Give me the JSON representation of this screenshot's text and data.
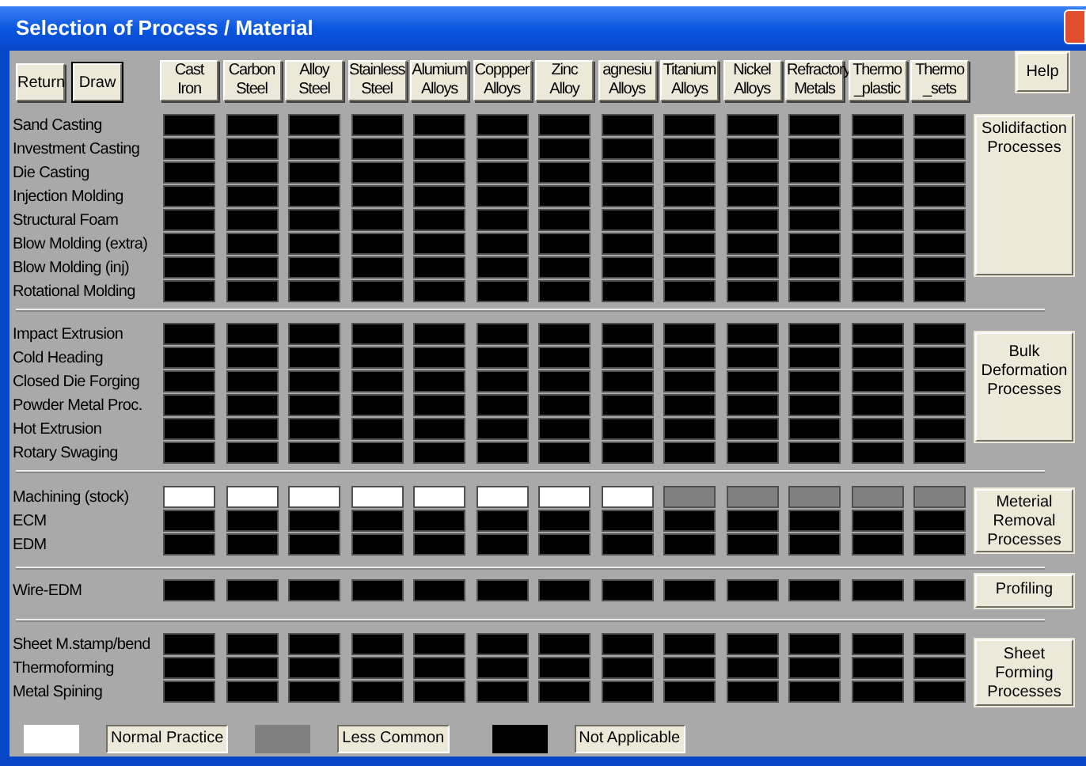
{
  "window": {
    "title": "Selection of Process / Material"
  },
  "toolbar": [
    {
      "label": "Return",
      "default": false
    },
    {
      "label": "Draw",
      "default": true
    }
  ],
  "help_button": "Help",
  "materials": [
    "Cast\nIron",
    "Carbon\nSteel",
    "Alloy\nSteel",
    "Stainless\nSteel",
    "Alumium\nAlloys",
    "Coppper\nAlloys",
    "Zinc\nAlloy",
    "agnesiu\nAlloys",
    "Titanium\nAlloys",
    "Nickel\nAlloys",
    "Refractory\nMetals",
    "Thermo\n_plastic",
    "Thermo\n_sets"
  ],
  "groups": [
    {
      "category": "Solidifaction\nProcesses",
      "processes": [
        {
          "name": "Sand Casting",
          "cells": [
            {
              "kind": "na"
            },
            {
              "kind": "na"
            },
            {
              "kind": "na"
            },
            {
              "kind": "na"
            },
            {
              "kind": "na"
            },
            {
              "kind": "na"
            },
            {
              "kind": "na"
            },
            {
              "kind": "na"
            },
            {
              "kind": "na"
            },
            {
              "kind": "na"
            },
            {
              "kind": "na"
            },
            {
              "kind": "na"
            },
            {
              "kind": "na"
            }
          ]
        },
        {
          "name": "Investment Casting",
          "cells": [
            {
              "kind": "na"
            },
            {
              "kind": "na"
            },
            {
              "kind": "na"
            },
            {
              "kind": "na"
            },
            {
              "kind": "na"
            },
            {
              "kind": "na"
            },
            {
              "kind": "na"
            },
            {
              "kind": "na"
            },
            {
              "kind": "na"
            },
            {
              "kind": "na"
            },
            {
              "kind": "na"
            },
            {
              "kind": "na"
            },
            {
              "kind": "na"
            }
          ]
        },
        {
          "name": "Die Casting",
          "cells": [
            {
              "kind": "na"
            },
            {
              "kind": "na"
            },
            {
              "kind": "na"
            },
            {
              "kind": "na"
            },
            {
              "kind": "na"
            },
            {
              "kind": "na"
            },
            {
              "kind": "na"
            },
            {
              "kind": "na"
            },
            {
              "kind": "na"
            },
            {
              "kind": "na"
            },
            {
              "kind": "na"
            },
            {
              "kind": "na"
            },
            {
              "kind": "na"
            }
          ]
        },
        {
          "name": "Injection Molding",
          "cells": [
            {
              "kind": "na"
            },
            {
              "kind": "na"
            },
            {
              "kind": "na"
            },
            {
              "kind": "na"
            },
            {
              "kind": "na"
            },
            {
              "kind": "na"
            },
            {
              "kind": "na"
            },
            {
              "kind": "na"
            },
            {
              "kind": "na"
            },
            {
              "kind": "na"
            },
            {
              "kind": "na"
            },
            {
              "kind": "na"
            },
            {
              "kind": "na"
            }
          ]
        },
        {
          "name": "Structural Foam",
          "cells": [
            {
              "kind": "na"
            },
            {
              "kind": "na"
            },
            {
              "kind": "na"
            },
            {
              "kind": "na"
            },
            {
              "kind": "na"
            },
            {
              "kind": "na"
            },
            {
              "kind": "na"
            },
            {
              "kind": "na"
            },
            {
              "kind": "na"
            },
            {
              "kind": "na"
            },
            {
              "kind": "na"
            },
            {
              "kind": "na"
            },
            {
              "kind": "na"
            }
          ]
        },
        {
          "name": "Blow Molding (extra)",
          "cells": [
            {
              "kind": "na"
            },
            {
              "kind": "na"
            },
            {
              "kind": "na"
            },
            {
              "kind": "na"
            },
            {
              "kind": "na"
            },
            {
              "kind": "na"
            },
            {
              "kind": "na"
            },
            {
              "kind": "na"
            },
            {
              "kind": "na"
            },
            {
              "kind": "na"
            },
            {
              "kind": "na"
            },
            {
              "kind": "na"
            },
            {
              "kind": "na"
            }
          ]
        },
        {
          "name": "Blow Molding (inj)",
          "cells": [
            {
              "kind": "na"
            },
            {
              "kind": "na"
            },
            {
              "kind": "na"
            },
            {
              "kind": "na"
            },
            {
              "kind": "na"
            },
            {
              "kind": "na"
            },
            {
              "kind": "na"
            },
            {
              "kind": "na"
            },
            {
              "kind": "na"
            },
            {
              "kind": "na"
            },
            {
              "kind": "na"
            },
            {
              "kind": "na"
            },
            {
              "kind": "na"
            }
          ]
        },
        {
          "name": "Rotational Molding",
          "cells": [
            {
              "kind": "na"
            },
            {
              "kind": "na"
            },
            {
              "kind": "na"
            },
            {
              "kind": "na"
            },
            {
              "kind": "na"
            },
            {
              "kind": "na"
            },
            {
              "kind": "na"
            },
            {
              "kind": "na"
            },
            {
              "kind": "na"
            },
            {
              "kind": "na"
            },
            {
              "kind": "na"
            },
            {
              "kind": "na"
            },
            {
              "kind": "na"
            }
          ]
        }
      ]
    },
    {
      "category": "Bulk\nDeformation\nProcesses",
      "processes": [
        {
          "name": "Impact Extrusion",
          "cells": [
            {
              "kind": "na"
            },
            {
              "kind": "na"
            },
            {
              "kind": "na"
            },
            {
              "kind": "na"
            },
            {
              "kind": "na"
            },
            {
              "kind": "na"
            },
            {
              "kind": "na"
            },
            {
              "kind": "na"
            },
            {
              "kind": "na"
            },
            {
              "kind": "na"
            },
            {
              "kind": "na"
            },
            {
              "kind": "na"
            },
            {
              "kind": "na"
            }
          ]
        },
        {
          "name": "Cold Heading",
          "cells": [
            {
              "kind": "na"
            },
            {
              "kind": "na"
            },
            {
              "kind": "na"
            },
            {
              "kind": "na"
            },
            {
              "kind": "na"
            },
            {
              "kind": "na"
            },
            {
              "kind": "na"
            },
            {
              "kind": "na"
            },
            {
              "kind": "na"
            },
            {
              "kind": "na"
            },
            {
              "kind": "na"
            },
            {
              "kind": "na"
            },
            {
              "kind": "na"
            }
          ]
        },
        {
          "name": "Closed Die Forging",
          "cells": [
            {
              "kind": "na"
            },
            {
              "kind": "na"
            },
            {
              "kind": "na"
            },
            {
              "kind": "na"
            },
            {
              "kind": "na"
            },
            {
              "kind": "na"
            },
            {
              "kind": "na"
            },
            {
              "kind": "na"
            },
            {
              "kind": "na"
            },
            {
              "kind": "na"
            },
            {
              "kind": "na"
            },
            {
              "kind": "na"
            },
            {
              "kind": "na"
            }
          ]
        },
        {
          "name": "Powder Metal Proc.",
          "cells": [
            {
              "kind": "na"
            },
            {
              "kind": "na"
            },
            {
              "kind": "na"
            },
            {
              "kind": "na"
            },
            {
              "kind": "na"
            },
            {
              "kind": "na"
            },
            {
              "kind": "na"
            },
            {
              "kind": "na"
            },
            {
              "kind": "na"
            },
            {
              "kind": "na"
            },
            {
              "kind": "na"
            },
            {
              "kind": "na"
            },
            {
              "kind": "na"
            }
          ]
        },
        {
          "name": "Hot Extrusion",
          "cells": [
            {
              "kind": "na"
            },
            {
              "kind": "na"
            },
            {
              "kind": "na"
            },
            {
              "kind": "na"
            },
            {
              "kind": "na"
            },
            {
              "kind": "na"
            },
            {
              "kind": "na"
            },
            {
              "kind": "na"
            },
            {
              "kind": "na"
            },
            {
              "kind": "na"
            },
            {
              "kind": "na"
            },
            {
              "kind": "na"
            },
            {
              "kind": "na"
            }
          ]
        },
        {
          "name": "Rotary Swaging",
          "cells": [
            {
              "kind": "na"
            },
            {
              "kind": "na"
            },
            {
              "kind": "na"
            },
            {
              "kind": "na"
            },
            {
              "kind": "na"
            },
            {
              "kind": "na"
            },
            {
              "kind": "na"
            },
            {
              "kind": "na"
            },
            {
              "kind": "na"
            },
            {
              "kind": "na"
            },
            {
              "kind": "na"
            },
            {
              "kind": "na"
            },
            {
              "kind": "na"
            }
          ]
        }
      ]
    },
    {
      "category": "Meterial\nRemoval\nProcesses",
      "processes": [
        {
          "name": "Machining (stock)",
          "cells": [
            {
              "kind": "normal"
            },
            {
              "kind": "normal"
            },
            {
              "kind": "normal"
            },
            {
              "kind": "normal"
            },
            {
              "kind": "normal"
            },
            {
              "kind": "normal"
            },
            {
              "kind": "normal"
            },
            {
              "kind": "normal"
            },
            {
              "kind": "less"
            },
            {
              "kind": "less"
            },
            {
              "kind": "less"
            },
            {
              "kind": "less"
            },
            {
              "kind": "less"
            }
          ]
        },
        {
          "name": "ECM",
          "cells": [
            {
              "kind": "na"
            },
            {
              "kind": "na"
            },
            {
              "kind": "na"
            },
            {
              "kind": "na"
            },
            {
              "kind": "na"
            },
            {
              "kind": "na"
            },
            {
              "kind": "na"
            },
            {
              "kind": "na"
            },
            {
              "kind": "na"
            },
            {
              "kind": "na"
            },
            {
              "kind": "na"
            },
            {
              "kind": "na"
            },
            {
              "kind": "na"
            }
          ]
        },
        {
          "name": "EDM",
          "cells": [
            {
              "kind": "na"
            },
            {
              "kind": "na"
            },
            {
              "kind": "na"
            },
            {
              "kind": "na"
            },
            {
              "kind": "na"
            },
            {
              "kind": "na"
            },
            {
              "kind": "na"
            },
            {
              "kind": "na"
            },
            {
              "kind": "na"
            },
            {
              "kind": "na"
            },
            {
              "kind": "na"
            },
            {
              "kind": "na"
            },
            {
              "kind": "na"
            }
          ]
        }
      ]
    },
    {
      "category": "Profiling",
      "processes": [
        {
          "name": "Wire-EDM",
          "cells": [
            {
              "kind": "na"
            },
            {
              "kind": "na"
            },
            {
              "kind": "na"
            },
            {
              "kind": "na"
            },
            {
              "kind": "na"
            },
            {
              "kind": "na"
            },
            {
              "kind": "na"
            },
            {
              "kind": "na"
            },
            {
              "kind": "na"
            },
            {
              "kind": "na"
            },
            {
              "kind": "na"
            },
            {
              "kind": "na"
            },
            {
              "kind": "na"
            }
          ]
        }
      ]
    },
    {
      "category": "Sheet\nForming\nProcesses",
      "processes": [
        {
          "name": "Sheet M.stamp/bend",
          "cells": [
            {
              "kind": "na"
            },
            {
              "kind": "na"
            },
            {
              "kind": "na"
            },
            {
              "kind": "na"
            },
            {
              "kind": "na"
            },
            {
              "kind": "na"
            },
            {
              "kind": "na"
            },
            {
              "kind": "na"
            },
            {
              "kind": "na"
            },
            {
              "kind": "na"
            },
            {
              "kind": "na"
            },
            {
              "kind": "na"
            },
            {
              "kind": "na"
            }
          ]
        },
        {
          "name": "Thermoforming",
          "cells": [
            {
              "kind": "na"
            },
            {
              "kind": "na"
            },
            {
              "kind": "na"
            },
            {
              "kind": "na"
            },
            {
              "kind": "na"
            },
            {
              "kind": "na"
            },
            {
              "kind": "na"
            },
            {
              "kind": "na"
            },
            {
              "kind": "na"
            },
            {
              "kind": "na"
            },
            {
              "kind": "na"
            },
            {
              "kind": "na"
            },
            {
              "kind": "na"
            }
          ]
        },
        {
          "name": "Metal Spining",
          "cells": [
            {
              "kind": "na"
            },
            {
              "kind": "na"
            },
            {
              "kind": "na"
            },
            {
              "kind": "na"
            },
            {
              "kind": "na"
            },
            {
              "kind": "na"
            },
            {
              "kind": "na"
            },
            {
              "kind": "na"
            },
            {
              "kind": "na"
            },
            {
              "kind": "na"
            },
            {
              "kind": "na"
            },
            {
              "kind": "na"
            },
            {
              "kind": "na"
            }
          ]
        }
      ]
    }
  ],
  "legend": [
    {
      "kind": "normal",
      "label": "Normal Practice"
    },
    {
      "kind": "less",
      "label": "Less Common"
    },
    {
      "kind": "na",
      "label": "Not Applicable"
    }
  ]
}
